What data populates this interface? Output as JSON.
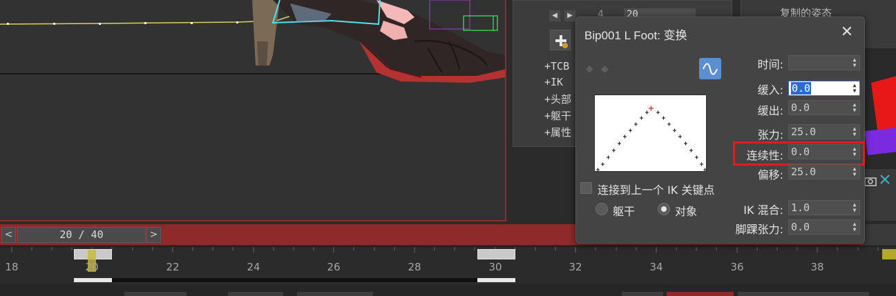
{
  "command_panel": {
    "spinner_label": "4",
    "spinner_value": "20",
    "rollouts": [
      "+TCB",
      "+IK",
      "+头部",
      "+躯干",
      "+属性"
    ]
  },
  "far_right": {
    "copy_pose_label": "复制的姿态"
  },
  "scrubber": {
    "value": "20 / 40",
    "prev_glyph": "<",
    "next_glyph": ">"
  },
  "timeline": {
    "ticks": [
      "18",
      "20",
      "22",
      "24",
      "26",
      "28",
      "30",
      "32",
      "34",
      "36",
      "38"
    ],
    "current_frame": "20"
  },
  "dialog": {
    "title": "Bip001 L Foot: 变换",
    "close_glyph": "✕",
    "fields": {
      "time": {
        "label": "时间:",
        "value": ""
      },
      "ease_in": {
        "label": "缓入:",
        "value": "0.0"
      },
      "ease_out": {
        "label": "缓出:",
        "value": "0.0"
      },
      "tension": {
        "label": "张力:",
        "value": "25.0"
      },
      "continuity": {
        "label": "连续性:",
        "value": "0.0"
      },
      "bias": {
        "label": "偏移:",
        "value": "25.0"
      },
      "ik_blend": {
        "label": "IK 混合:",
        "value": "1.0"
      },
      "ankle_tension": {
        "label": "脚踝张力:",
        "value": "0.0"
      }
    },
    "ik_checkbox_label": "连接到上一个 IK 关键点",
    "radio_body": "躯干",
    "radio_object": "对象",
    "radio_selected": "object"
  },
  "colors": {
    "highlight": "#e21b1b",
    "accent_blue": "#5d8fd0",
    "scrubber_red": "#8f2a2a"
  }
}
